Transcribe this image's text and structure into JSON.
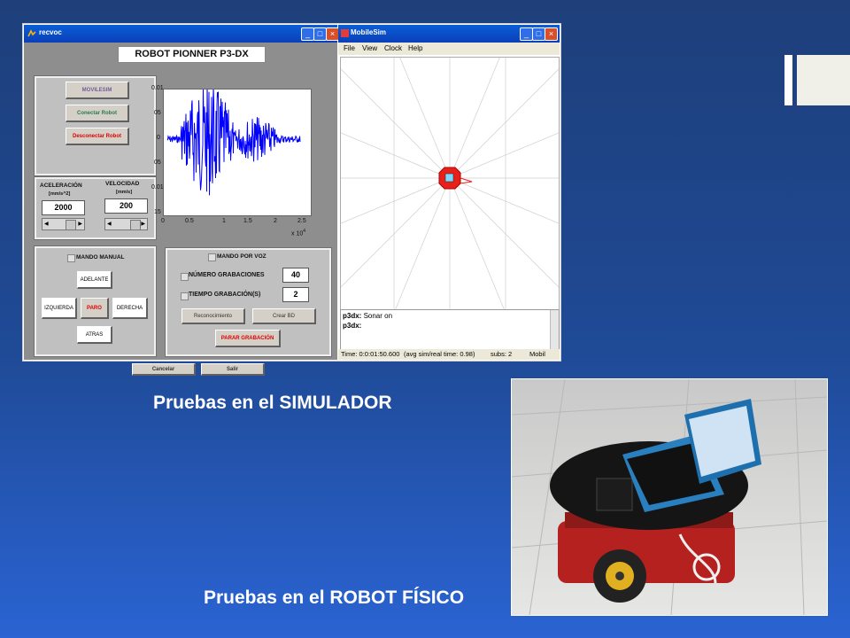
{
  "matlab": {
    "window_title": "recvoc",
    "main_title": "ROBOT PIONNER P3-DX",
    "buttons": {
      "movilesim": "MOVILESIM",
      "conectar": "Conectar Robot",
      "desconectar": "Desconectar Robot"
    },
    "aceleracion": {
      "label": "ACELERACIÓN",
      "unit": "[mm/s^2]",
      "value": "2000"
    },
    "velocidad": {
      "label": "VELOCIDAD",
      "unit": "[mm/s]",
      "value": "200"
    },
    "manual": {
      "title": "MANDO MANUAL",
      "adelante": "ADELANTE",
      "izquierda": "IZQUIERDA",
      "paro": "PARO",
      "derecha": "DERECHA",
      "atras": "ATRAS"
    },
    "voz": {
      "title": "MANDO POR VOZ",
      "num_label": "NÚMERO GRABACIONES",
      "num_value": "40",
      "tiempo_label": "TIEMPO GRABACIÓN(S)",
      "tiempo_value": "2",
      "reconocimiento": "Reconocimiento",
      "crear": "Crear BD",
      "parar": "PARAR GRABACIÓN"
    },
    "cancelar": "Cancelar",
    "salir": "Salir",
    "plot": {
      "yticks": [
        "0.01",
        "05",
        "0",
        "05",
        "0.01",
        "15"
      ],
      "xticks": [
        "0",
        "0.5",
        "1",
        "1.5",
        "2",
        "2.5"
      ],
      "xscale": "x 10",
      "xscale_exp": "4"
    }
  },
  "mobilesim": {
    "window_title": "MobileSim",
    "menu": [
      "File",
      "View",
      "Clock",
      "Help"
    ],
    "log": [
      {
        "who": "p3dx:",
        "msg": " Sonar on"
      },
      {
        "who": "p3dx:",
        "msg": ""
      }
    ],
    "status": {
      "time": "Time: 0:0:01:50.600",
      "avg": "(avg sim/real time: 0.98)",
      "subs": "subs: 2",
      "mobil": "Mobil"
    }
  },
  "captions": {
    "simulador": "Pruebas en el SIMULADOR",
    "fisico": "Pruebas en el ROBOT FÍSICO"
  },
  "colors": {
    "titlebar": "#0a4fd0",
    "red_button_text": "#e00000",
    "waveform": "#0000ff",
    "robot": "#e8201c"
  }
}
